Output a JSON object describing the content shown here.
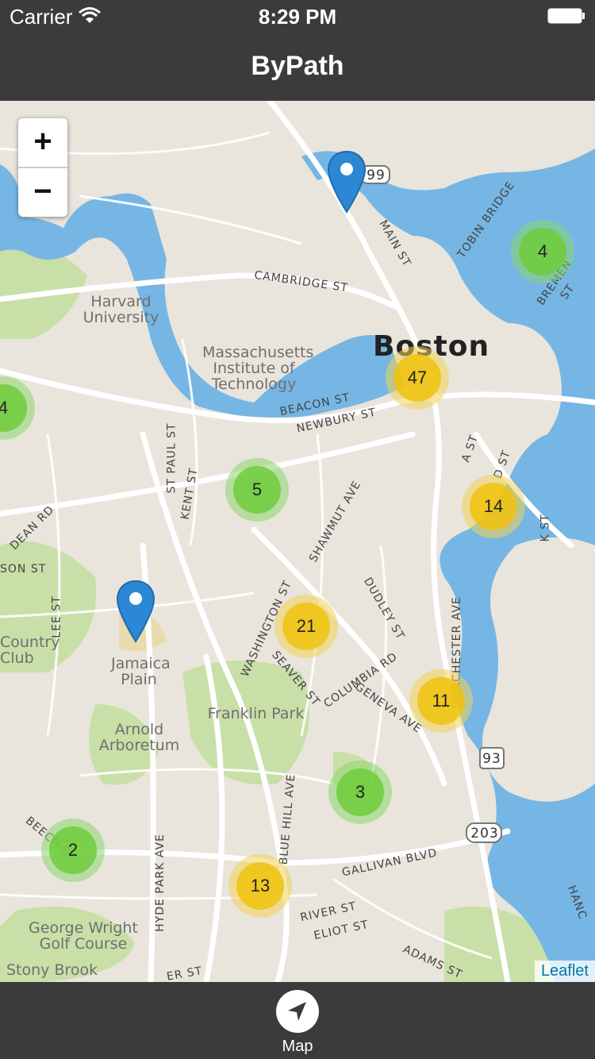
{
  "status_bar": {
    "carrier": "Carrier",
    "time": "8:29 PM",
    "wifi_icon": "wifi-icon",
    "battery_icon": "battery-icon"
  },
  "nav": {
    "title": "ByPath"
  },
  "map": {
    "zoom_in": "+",
    "zoom_out": "−",
    "attribution": "Leaflet",
    "city_label": "Boston",
    "places": [
      "Harvard University",
      "Massachusetts Institute of Technology",
      "Jamaica Plain",
      "Arnold Arboretum",
      "Franklin Park",
      "Country Club",
      "George Wright Golf Course",
      "Stony Brook"
    ],
    "streets": [
      "CAMBRIDGE ST",
      "BEACON ST",
      "NEWBURY ST",
      "MAIN ST",
      "TOBIN BRIDGE",
      "ST PAUL ST",
      "KENT ST",
      "DEAN RD",
      "LEE ST",
      "SHAWMUT AVE",
      "WASHINGTON ST",
      "DUDLEY ST",
      "COLUMBIA RD",
      "SEAVER ST",
      "GENEVA AVE",
      "DORCHESTER AVE",
      "A ST",
      "D ST",
      "K ST",
      "BLUE HILL AVE",
      "GALLIVAN BLVD",
      "RIVER ST",
      "ELIOT ST",
      "ADAMS ST",
      "HYDE PARK AVE",
      "BEECH ST",
      "BREMEN ST",
      "SON ST",
      "ER ST",
      "HANC"
    ],
    "route_shields": [
      "99",
      "93",
      "203"
    ],
    "clusters": [
      {
        "count": "4",
        "level": "green"
      },
      {
        "count": "47",
        "level": "yellow"
      },
      {
        "count": "4",
        "level": "green"
      },
      {
        "count": "5",
        "level": "green"
      },
      {
        "count": "14",
        "level": "yellow"
      },
      {
        "count": "21",
        "level": "yellow"
      },
      {
        "count": "11",
        "level": "yellow"
      },
      {
        "count": "3",
        "level": "green"
      },
      {
        "count": "2",
        "level": "green"
      },
      {
        "count": "13",
        "level": "yellow"
      }
    ],
    "markers": [
      "map-pin-icon",
      "map-pin-icon"
    ]
  },
  "tab_bar": {
    "items": [
      {
        "label": "Map",
        "icon": "location-arrow-icon",
        "selected": true
      }
    ]
  },
  "colors": {
    "bar": "#3b3b3b",
    "water": "#76b6e4",
    "park": "#c9dfa8",
    "land": "#e9e5dc",
    "pin": "#2c87d4"
  }
}
